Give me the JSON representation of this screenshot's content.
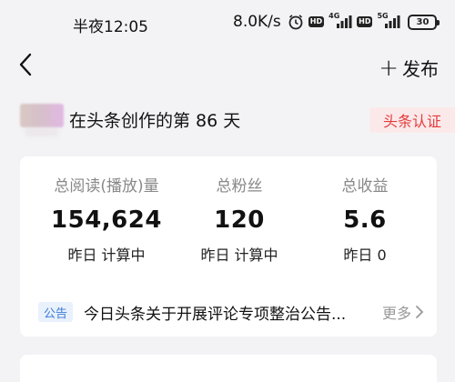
{
  "status_bar": {
    "time": "半夜12:05",
    "net_speed": "8.0K/s",
    "icons": [
      "alarm-icon",
      "hd-icon",
      "signal-4g-icon",
      "hd-icon",
      "signal-5g-icon",
      "battery-icon"
    ],
    "sim1_tag": "4G",
    "sim2_tag": "5G",
    "hd_label": "HD",
    "battery": "30"
  },
  "nav": {
    "publish_plus": "+",
    "publish_label": "发布"
  },
  "profile": {
    "days_text": "在头条创作的第 86 天",
    "verify_badge": "头条认证"
  },
  "stats": [
    {
      "label": "总阅读(播放)量",
      "value": "154,624",
      "sub": "昨日 计算中"
    },
    {
      "label": "总粉丝",
      "value": "120",
      "sub": "昨日 计算中"
    },
    {
      "label": "总收益",
      "value": "5.6",
      "sub": "昨日 0"
    }
  ],
  "notice": {
    "tag": "公告",
    "text": "今日头条关于开展评论专项整治公告...",
    "more": "更多"
  }
}
